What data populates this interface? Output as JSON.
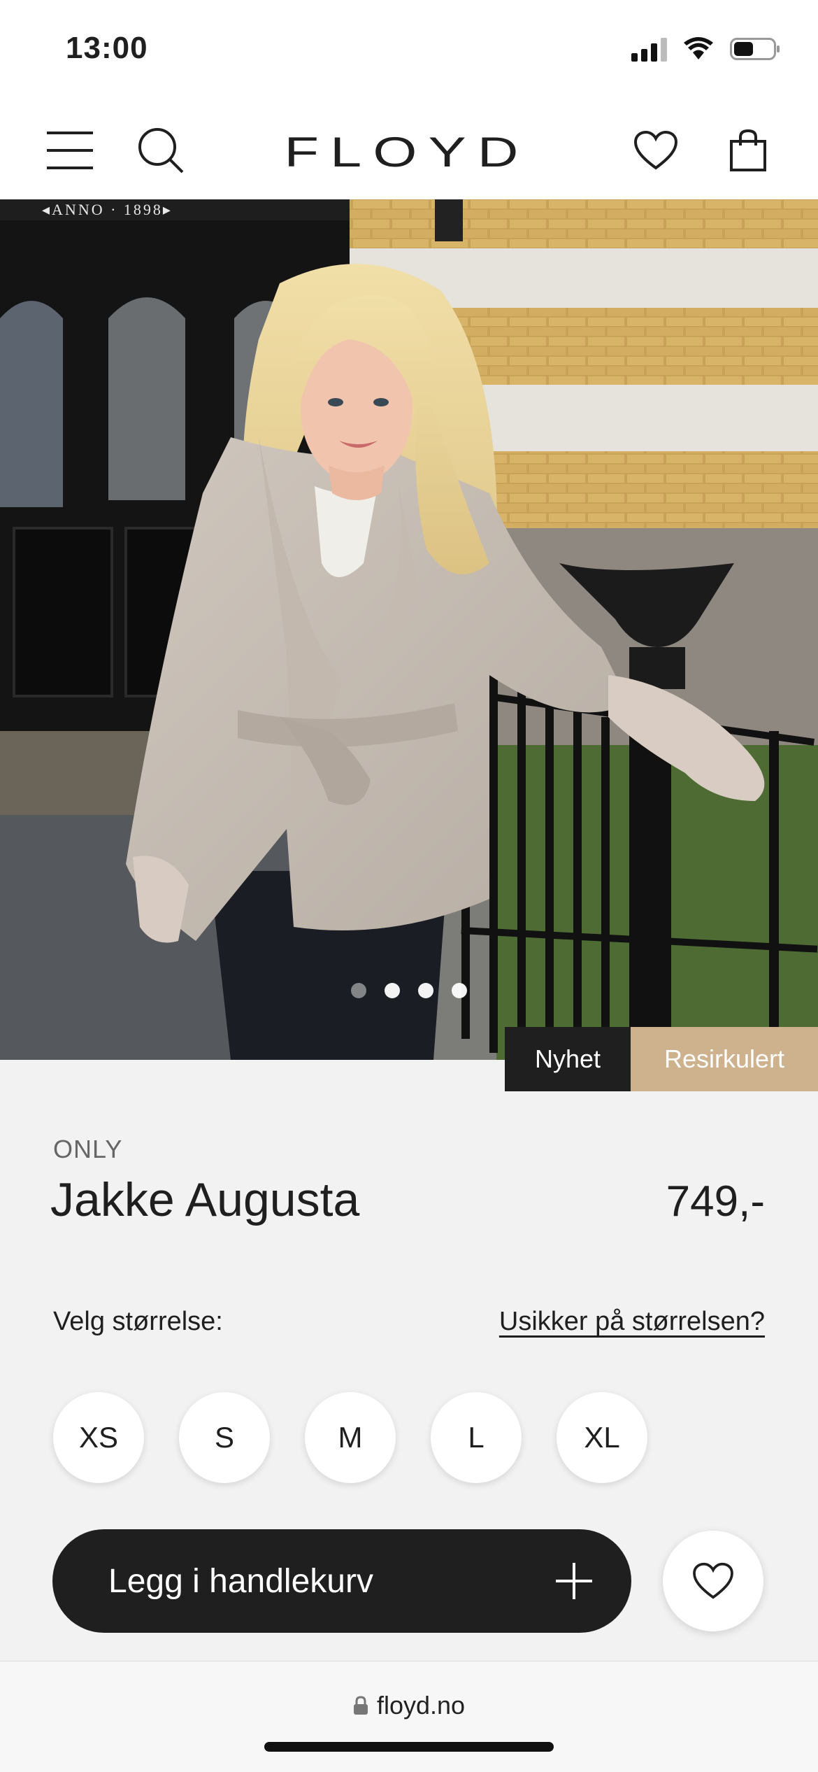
{
  "status": {
    "time": "13:00"
  },
  "header": {
    "logo": "FLOYD"
  },
  "hero": {
    "sign_text": "◂ANNO · 1898▸",
    "carousel_active_index": 0,
    "carousel_count": 4
  },
  "badges": {
    "new": "Nyhet",
    "recycled": "Resirkulert"
  },
  "product": {
    "brand": "ONLY",
    "name": "Jakke Augusta",
    "price": "749,-"
  },
  "size": {
    "label": "Velg størrelse:",
    "help_link": "Usikker på størrelsen?",
    "options": [
      "XS",
      "S",
      "M",
      "L",
      "XL"
    ]
  },
  "actions": {
    "add_to_cart": "Legg i handlekurv"
  },
  "browser": {
    "url": "floyd.no"
  },
  "colors": {
    "dark": "#1f1f1f",
    "recycled_badge": "#cdb28d",
    "background": "#f2f2f2"
  }
}
